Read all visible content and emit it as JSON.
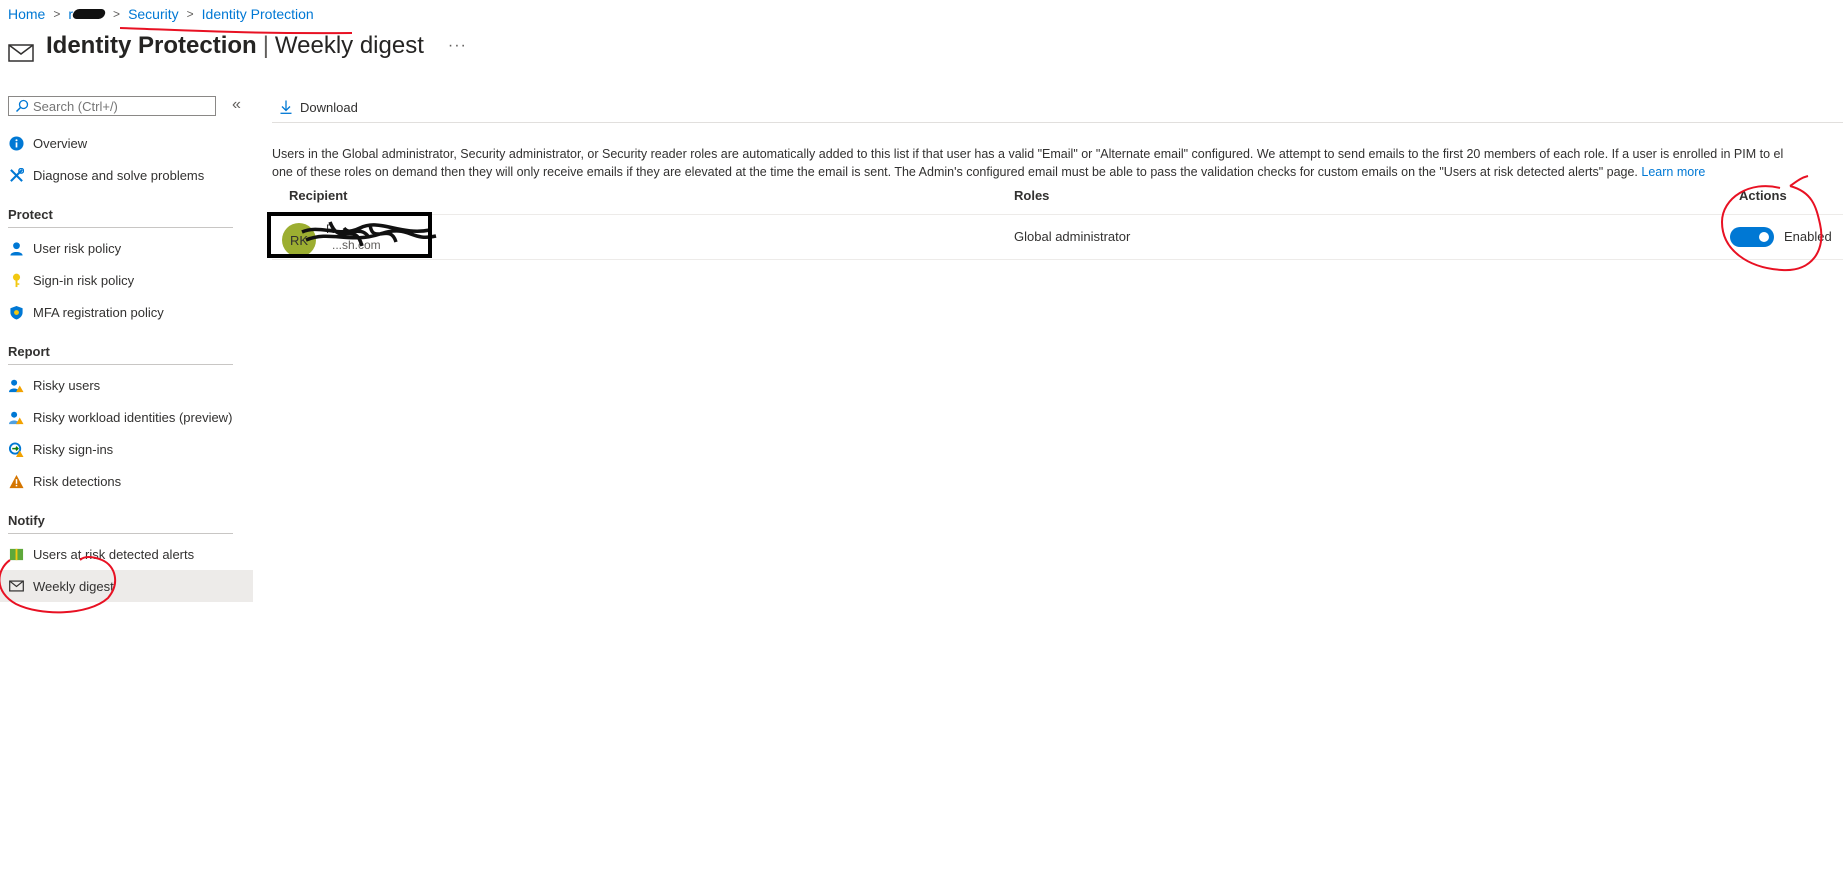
{
  "breadcrumb": {
    "home": "Home",
    "tenant": "r",
    "security": "Security",
    "identity_protection": "Identity Protection"
  },
  "header": {
    "title": "Identity Protection",
    "subtitle": "Weekly digest",
    "more": "···"
  },
  "sidebar": {
    "search_placeholder": "Search (Ctrl+/)",
    "collapse": "«",
    "top_items": [
      {
        "label": "Overview",
        "icon": "info-icon"
      },
      {
        "label": "Diagnose and solve problems",
        "icon": "wrench-icon"
      }
    ],
    "sections": [
      {
        "title": "Protect",
        "items": [
          {
            "label": "User risk policy",
            "icon": "user-icon"
          },
          {
            "label": "Sign-in risk policy",
            "icon": "key-icon"
          },
          {
            "label": "MFA registration policy",
            "icon": "shield-icon"
          }
        ]
      },
      {
        "title": "Report",
        "items": [
          {
            "label": "Risky users",
            "icon": "risky-users-icon"
          },
          {
            "label": "Risky workload identities (preview)",
            "icon": "risky-workload-icon"
          },
          {
            "label": "Risky sign-ins",
            "icon": "risky-signin-icon"
          },
          {
            "label": "Risk detections",
            "icon": "warning-icon"
          }
        ]
      },
      {
        "title": "Notify",
        "items": [
          {
            "label": "Users at risk detected alerts",
            "icon": "alerts-icon"
          },
          {
            "label": "Weekly digest",
            "icon": "mail-icon",
            "active": true
          }
        ]
      }
    ]
  },
  "toolbar": {
    "download_label": "Download"
  },
  "info": {
    "line1": "Users in the Global administrator, Security administrator, or Security reader roles are automatically added to this list if that user has a valid \"Email\" or \"Alternate email\" configured. We attempt to send emails to the first 20 members of each role. If a user is enrolled in PIM to el",
    "line2": "one of these roles on demand then they will only receive emails if they are elevated at the time the email is sent. The Admin's configured email must be able to pass the validation checks for custom emails on the \"Users at risk detected alerts\" page.",
    "learn_more": "Learn more"
  },
  "table": {
    "columns": [
      "Recipient",
      "Roles",
      "Actions"
    ],
    "rows": [
      {
        "initials": "RK",
        "name": "R",
        "email": "...sh.com",
        "role": "Global administrator",
        "action": "Enabled"
      }
    ]
  },
  "colors": {
    "accent": "#0078d4",
    "avatar": "#9cae31",
    "annotation": "#e81123"
  }
}
